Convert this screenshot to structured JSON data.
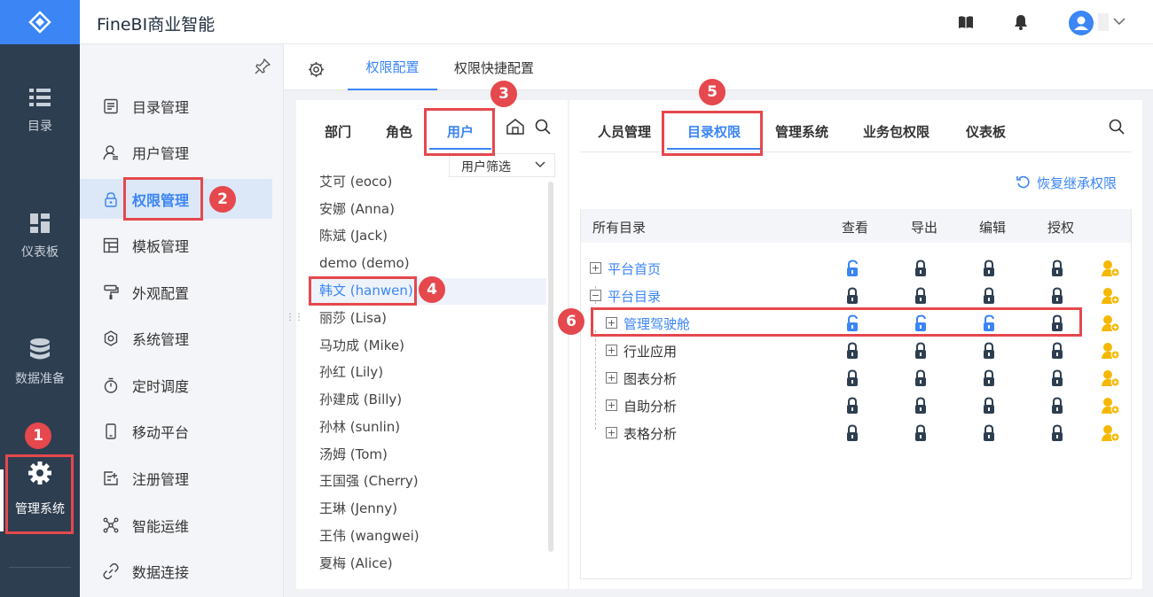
{
  "app": {
    "title": "FineBI商业智能"
  },
  "rail": {
    "items": [
      {
        "label": "目录",
        "icon": "list-icon"
      },
      {
        "label": "仪表板",
        "icon": "dashboard-icon"
      },
      {
        "label": "数据准备",
        "icon": "database-icon"
      },
      {
        "label": "管理系统",
        "icon": "gear-icon"
      }
    ]
  },
  "sidenav": {
    "items": [
      {
        "label": "目录管理"
      },
      {
        "label": "用户管理"
      },
      {
        "label": "权限管理"
      },
      {
        "label": "模板管理"
      },
      {
        "label": "外观配置"
      },
      {
        "label": "系统管理"
      },
      {
        "label": "定时调度"
      },
      {
        "label": "移动平台"
      },
      {
        "label": "注册管理"
      },
      {
        "label": "智能运维"
      },
      {
        "label": "数据连接"
      }
    ]
  },
  "tabs": [
    {
      "label": "权限配置"
    },
    {
      "label": "权限快捷配置"
    }
  ],
  "left_panel": {
    "tabs": [
      {
        "label": "部门"
      },
      {
        "label": "角色"
      },
      {
        "label": "用户"
      }
    ],
    "filter_label": "用户筛选",
    "users": [
      "艾可 (eoco)",
      "安娜 (Anna)",
      "陈斌 (Jack)",
      "demo (demo)",
      "韩文 (hanwen)",
      "丽莎 (Lisa)",
      "马功成 (Mike)",
      "孙红 (Lily)",
      "孙建成 (Billy)",
      "孙林 (sunlin)",
      "汤姆 (Tom)",
      "王国强 (Cherry)",
      "王琳 (Jenny)",
      "王伟 (wangwei)",
      "夏梅 (Alice)"
    ]
  },
  "right_panel": {
    "tabs": [
      {
        "label": "人员管理"
      },
      {
        "label": "目录权限"
      },
      {
        "label": "管理系统"
      },
      {
        "label": "业务包权限"
      },
      {
        "label": "仪表板"
      }
    ],
    "restore_label": "恢复继承权限",
    "columns": [
      "所有目录",
      "查看",
      "导出",
      "编辑",
      "授权"
    ],
    "rows": [
      {
        "name": "平台首页",
        "expand": "+",
        "perms": [
          "unlocked",
          "locked",
          "locked",
          "locked"
        ]
      },
      {
        "name": "平台目录",
        "expand": "−",
        "perms": [
          "locked",
          "locked",
          "locked",
          "locked"
        ]
      },
      {
        "name": "管理驾驶舱",
        "expand": "+",
        "perms": [
          "unlocked",
          "unlocked",
          "unlocked",
          "locked"
        ]
      },
      {
        "name": "行业应用",
        "expand": "+",
        "perms": [
          "locked",
          "locked",
          "locked",
          "locked"
        ]
      },
      {
        "name": "图表分析",
        "expand": "+",
        "perms": [
          "locked",
          "locked",
          "locked",
          "locked"
        ]
      },
      {
        "name": "自助分析",
        "expand": "+",
        "perms": [
          "locked",
          "locked",
          "locked",
          "locked"
        ]
      },
      {
        "name": "表格分析",
        "expand": "+",
        "perms": [
          "locked",
          "locked",
          "locked",
          "locked"
        ]
      }
    ]
  },
  "steps": [
    "1",
    "2",
    "3",
    "4",
    "5",
    "6"
  ],
  "colors": {
    "accent": "#3b85f5",
    "rail": "#2d3e50",
    "callout": "#e5484d",
    "lock": "#2d3e50",
    "user_icon": "#f5b800"
  }
}
